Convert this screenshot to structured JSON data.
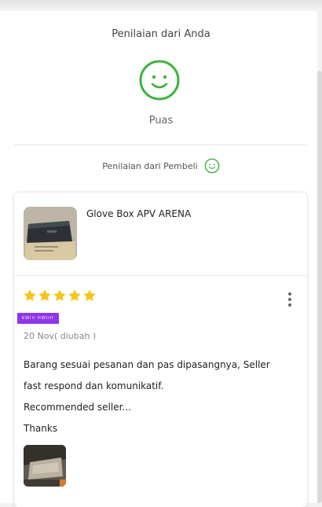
{
  "your_rating": {
    "title": "Penilaian dari Anda",
    "label": "Puas",
    "icon": "smiley-face-icon",
    "color": "#3db33d"
  },
  "buyer_rating": {
    "title": "Penilaian dari Pembeli",
    "icon": "smiley-face-icon"
  },
  "review": {
    "product_name": "Glove Box APV ARENA",
    "rating": 5,
    "max_rating": 5,
    "star_color": "#f5c518",
    "badge_text": "KWIII HWIIII",
    "badge_color": "#8e36e8",
    "date": "20 Nov( diubah )",
    "text_lines": [
      "Barang sesuai pesanan dan pas dipasangnya, Seller",
      "fast respond dan komunikatif.",
      "Recommended seller...",
      "Thanks"
    ],
    "more_icon": "more-vertical-icon"
  }
}
